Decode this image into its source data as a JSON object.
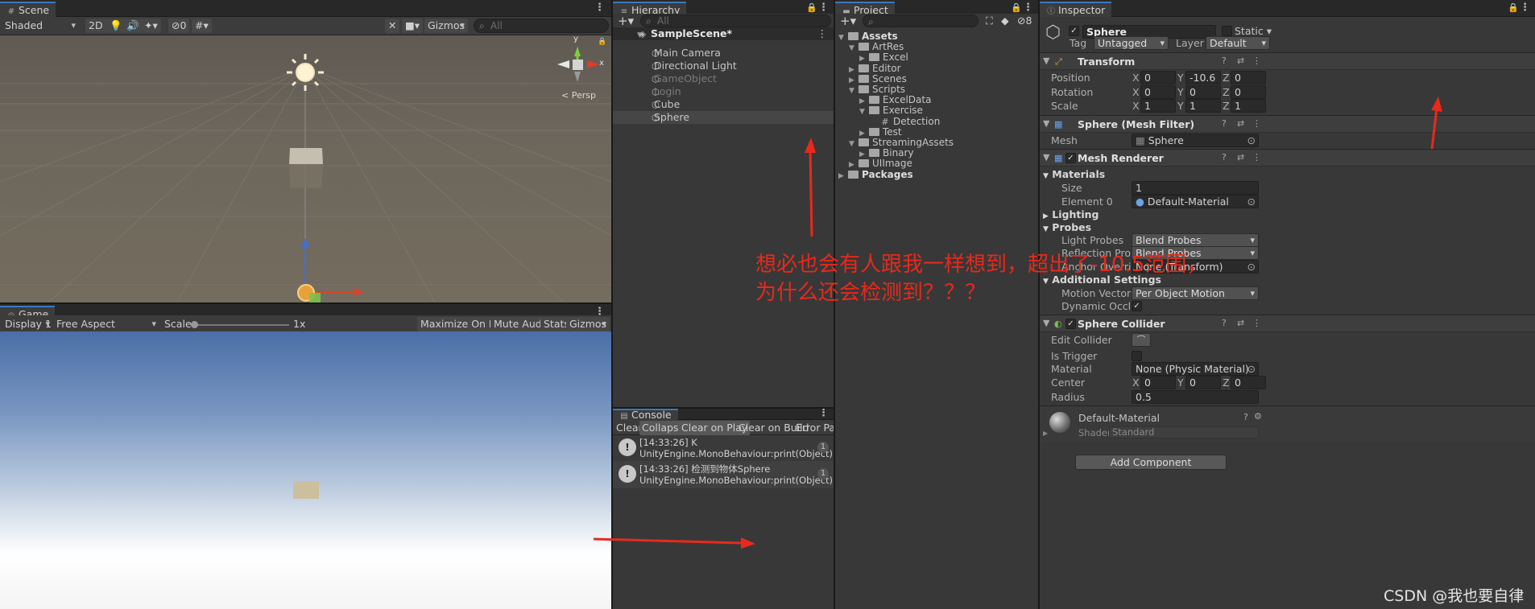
{
  "scene": {
    "tab": "Scene",
    "shading": "Shaded",
    "mode2d": "2D",
    "hidden_count": "0",
    "gizmos": "Gizmos",
    "search_placeholder": "All",
    "persp": "< Persp",
    "gizmo_y": "y",
    "gizmo_x": "x"
  },
  "game": {
    "tab": "Game",
    "display": "Display 1",
    "aspect": "Free Aspect",
    "scale_label": "Scale",
    "scale_value": "1x",
    "maximize": "Maximize On Play",
    "mute": "Mute Audio",
    "stats": "Stats",
    "gizmos": "Gizmos"
  },
  "hierarchy": {
    "tab": "Hierarchy",
    "search_placeholder": "All",
    "scene_name": "SampleScene*",
    "items": [
      {
        "label": "Main Camera",
        "active": true
      },
      {
        "label": "Directional Light",
        "active": true
      },
      {
        "label": "GameObject",
        "active": false
      },
      {
        "label": "Login",
        "active": false
      },
      {
        "label": "Cube",
        "active": true
      },
      {
        "label": "Sphere",
        "active": true
      }
    ]
  },
  "project": {
    "tab": "Project",
    "hidden_count": "8",
    "tree": {
      "assets": "Assets",
      "artres": "ArtRes",
      "excel": "Excel",
      "editor": "Editor",
      "scenes": "Scenes",
      "scripts": "Scripts",
      "exceldata": "ExcelData",
      "exercise": "Exercise",
      "detection": "Detection",
      "test": "Test",
      "streaming": "StreamingAssets",
      "binary": "Binary",
      "uiimage": "UIImage",
      "packages": "Packages"
    }
  },
  "console": {
    "tab": "Console",
    "clear": "Clear",
    "collapse": "Collapse",
    "clear_on_play": "Clear on Play",
    "clear_on_build": "Clear on Build",
    "error_pause": "Error Paus",
    "logs": [
      {
        "line1": "[14:33:26] K",
        "line2": "UnityEngine.MonoBehaviour:print(Object)",
        "count": "1"
      },
      {
        "line1": "[14:33:26] 检测到物体Sphere",
        "line2": "UnityEngine.MonoBehaviour:print(Object)",
        "count": "1"
      }
    ]
  },
  "inspector": {
    "tab": "Inspector",
    "object_name": "Sphere",
    "static_label": "Static",
    "tag_label": "Tag",
    "tag_value": "Untagged",
    "layer_label": "Layer",
    "layer_value": "Default",
    "transform": {
      "title": "Transform",
      "position_label": "Position",
      "rotation_label": "Rotation",
      "scale_label": "Scale",
      "position": [
        "0",
        "-10.6",
        "0"
      ],
      "rotation": [
        "0",
        "0",
        "0"
      ],
      "scale": [
        "1",
        "1",
        "1"
      ],
      "axes": [
        "X",
        "Y",
        "Z"
      ]
    },
    "mesh_filter": {
      "title": "Sphere (Mesh Filter)",
      "mesh_label": "Mesh",
      "mesh_value": "Sphere"
    },
    "mesh_renderer": {
      "title": "Mesh Renderer",
      "materials": "Materials",
      "size_label": "Size",
      "size_value": "1",
      "element_label": "Element 0",
      "element_value": "Default-Material",
      "lighting": "Lighting",
      "probes": "Probes",
      "light_probes_label": "Light Probes",
      "light_probes_value": "Blend Probes",
      "reflection_probes_label": "Reflection Probes",
      "reflection_probes_value": "Blend Probes",
      "anchor_label": "Anchor Override",
      "anchor_value": "None (Transform)",
      "additional": "Additional Settings",
      "motion_label": "Motion Vectors",
      "motion_value": "Per Object Motion",
      "dynamic_label": "Dynamic Occlusion"
    },
    "sphere_collider": {
      "title": "Sphere Collider",
      "edit_label": "Edit Collider",
      "trigger_label": "Is Trigger",
      "material_label": "Material",
      "material_value": "None (Physic Material)",
      "center_label": "Center",
      "center": [
        "0",
        "0",
        "0"
      ],
      "radius_label": "Radius",
      "radius_value": "0.5"
    },
    "material": {
      "name": "Default-Material",
      "shader_label": "Shader",
      "shader_value": "Standard"
    },
    "add_component": "Add Component"
  },
  "annotation": {
    "line1": "想必也会有人跟我一样想到，超出了-10.5范围，",
    "line2": "为什么还会检测到？？？",
    "color": "#e8291c"
  },
  "watermark": "CSDN @我也要自律"
}
